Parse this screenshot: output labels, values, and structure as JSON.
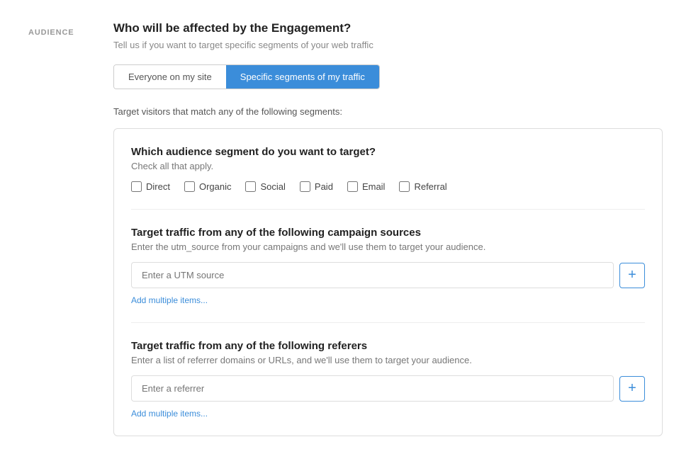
{
  "sidebar": {
    "label": "Audience"
  },
  "header": {
    "title": "Who will be affected by the Engagement?",
    "subtitle": "Tell us if you want to target specific segments of your web traffic"
  },
  "toggle": {
    "option1": "Everyone on my site",
    "option2": "Specific segments of my traffic"
  },
  "target_label": "Target visitors that match any of the following segments:",
  "segment_section": {
    "title": "Which audience segment do you want to target?",
    "subtitle": "Check all that apply.",
    "checkboxes": [
      {
        "id": "direct",
        "label": "Direct"
      },
      {
        "id": "organic",
        "label": "Organic"
      },
      {
        "id": "social",
        "label": "Social"
      },
      {
        "id": "paid",
        "label": "Paid"
      },
      {
        "id": "email",
        "label": "Email"
      },
      {
        "id": "referral",
        "label": "Referral"
      }
    ]
  },
  "campaign_section": {
    "title": "Target traffic from any of the following campaign sources",
    "subtitle": "Enter the utm_source from your campaigns and we'll use them to target your audience.",
    "input_placeholder": "Enter a UTM source",
    "add_label": "+",
    "add_multiple_label": "Add multiple items..."
  },
  "referrer_section": {
    "title": "Target traffic from any of the following referers",
    "subtitle": "Enter a list of referrer domains or URLs, and we'll use them to target your audience.",
    "input_placeholder": "Enter a referrer",
    "add_label": "+",
    "add_multiple_label": "Add multiple items..."
  }
}
